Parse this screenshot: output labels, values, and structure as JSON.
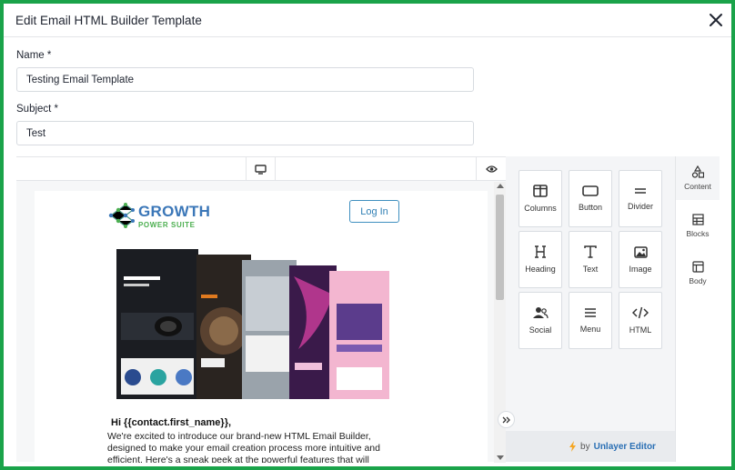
{
  "dialog": {
    "title": "Edit Email HTML Builder Template"
  },
  "form": {
    "name_label": "Name *",
    "name_value": "Testing Email Template",
    "subject_label": "Subject *",
    "subject_value": "Test"
  },
  "email": {
    "logo_main": "GROWTH",
    "logo_sub": "POWER SUITE",
    "login_label": "Log In",
    "greeting": "Hi {{contact.first_name}},",
    "paragraph": "We're excited to introduce our brand-new HTML Email Builder, designed to make your email creation process more intuitive and efficient. Here's a sneak peek at the powerful features that will transform how you craft your email"
  },
  "tools": {
    "columns": "Columns",
    "button": "Button",
    "divider": "Divider",
    "heading": "Heading",
    "text": "Text",
    "image": "Image",
    "social": "Social",
    "menu": "Menu",
    "html": "HTML"
  },
  "sidetabs": {
    "content": "Content",
    "blocks": "Blocks",
    "body": "Body"
  },
  "footer": {
    "by": "by",
    "editor": "Unlayer Editor"
  },
  "colors": {
    "frame": "#1aa34a",
    "accent": "#2f7fb4"
  }
}
